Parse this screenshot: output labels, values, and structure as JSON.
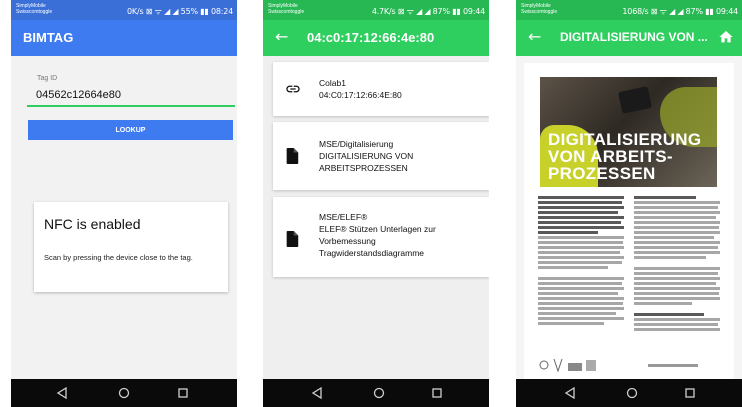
{
  "screens": [
    {
      "status": {
        "carrier": "SimplyMobile\nSwisscomtoggle",
        "right": "0K/s ⊠ ᯤ ◢ ◢ 55% ▮▮ 08:24"
      },
      "appbar": {
        "title": "BIMTAG",
        "color": "#3f7bf0"
      },
      "tag_label": "Tag ID",
      "tag_value": "04562c12664e80",
      "lookup_label": "LOOKUP",
      "nfc_heading": "NFC is enabled",
      "nfc_text": "Scan by pressing the device close to the tag."
    },
    {
      "status": {
        "carrier": "SimplyMobile\nSwisscomtoggle",
        "right": "4.7K/s ⊠ ᯤ ◢ ◢ 87% ▮▮ 09:44"
      },
      "appbar": {
        "title": "04:c0:17:12:66:4e:80",
        "color": "#2fcf5f"
      },
      "items": [
        {
          "icon": "link-icon",
          "lines": [
            "Colab1",
            "04:C0:17:12:66:4E:80"
          ]
        },
        {
          "icon": "document-icon",
          "lines": [
            "MSE/Digitalisierung",
            "DIGITALISIERUNG VON",
            "ARBEITSPROZESSEN"
          ]
        },
        {
          "icon": "document-icon",
          "lines": [
            "MSE/ELEF®",
            "ELEF® Stützen Unterlagen zur",
            "Vorbemessung",
            "Tragwiderstandsdiagramme"
          ]
        }
      ]
    },
    {
      "status": {
        "carrier": "SimplyMobile\nSwisscomtoggle",
        "right": "1068/s ⊠ ᯤ ◢ ◢ 87% ▮▮ 09:44"
      },
      "appbar": {
        "title": "DIGITALISIERUNG VON ...",
        "color": "#2fcf5f"
      },
      "doc_title": "DIGITALISIERUNG VON ARBEITS-PROZESSEN"
    }
  ]
}
